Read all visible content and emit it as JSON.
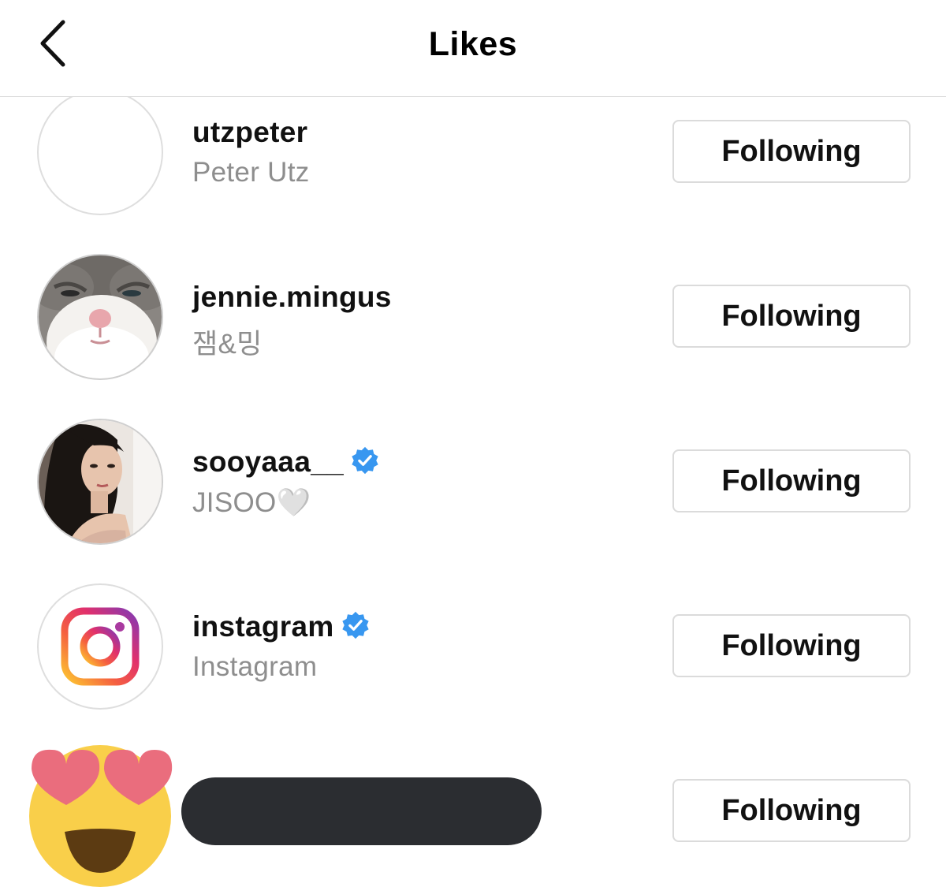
{
  "header": {
    "title": "Likes",
    "back_icon": "chevron-left-icon"
  },
  "users": [
    {
      "username": "utzpeter",
      "fullname": "Peter Utz",
      "verified": false,
      "button": "Following",
      "avatar": "blank-avatar"
    },
    {
      "username": "jennie.mingus",
      "fullname": "잼&밍",
      "verified": false,
      "button": "Following",
      "avatar": "cat-photo-avatar"
    },
    {
      "username": "sooyaaa__",
      "fullname": "JISOO🤍",
      "verified": true,
      "button": "Following",
      "avatar": "portrait-photo-avatar"
    },
    {
      "username": "instagram",
      "fullname": "Instagram",
      "verified": true,
      "button": "Following",
      "avatar": "instagram-logo-avatar"
    },
    {
      "button": "Following",
      "avatar": "heart-eyes-emoji-sticker"
    }
  ],
  "colors": {
    "verified_blue": "#3897f0",
    "secondary_text": "#8e8e8e",
    "button_border": "#dbdbdb",
    "redaction_bar": "#2b2d31"
  }
}
